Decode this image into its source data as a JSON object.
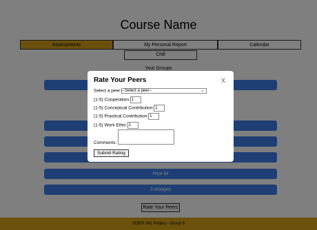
{
  "page": {
    "title": "Course Name",
    "tabs": [
      "Assessments",
      "My Personal Report",
      "Calendar"
    ],
    "chill_button": "Chill",
    "groups_label": "Your Groups",
    "groups": [
      "",
      "",
      "",
      "",
      "",
      "Hiya lol",
      "3 stooges"
    ],
    "rate_button": "Rate Your Peers",
    "footer": "SOEN 341 Project - Group 6"
  },
  "modal": {
    "title": "Rate Your Peers",
    "close": "X",
    "select_label": "Select a peer:",
    "select_value": "--Select a peer--",
    "fields": [
      {
        "label": "(1-5) Cooperation:",
        "value": "1"
      },
      {
        "label": "(1-5) Conceptual Contribution:",
        "value": "1"
      },
      {
        "label": "(1-5) Practical Contribution:",
        "value": "1"
      },
      {
        "label": "(1-5) Work Ethic:",
        "value": "1"
      }
    ],
    "comments_label": "Comments:",
    "submit": "Submit Rating"
  },
  "colors": {
    "accent": "#d8a21a",
    "group_bar": "#3f7ee8"
  }
}
